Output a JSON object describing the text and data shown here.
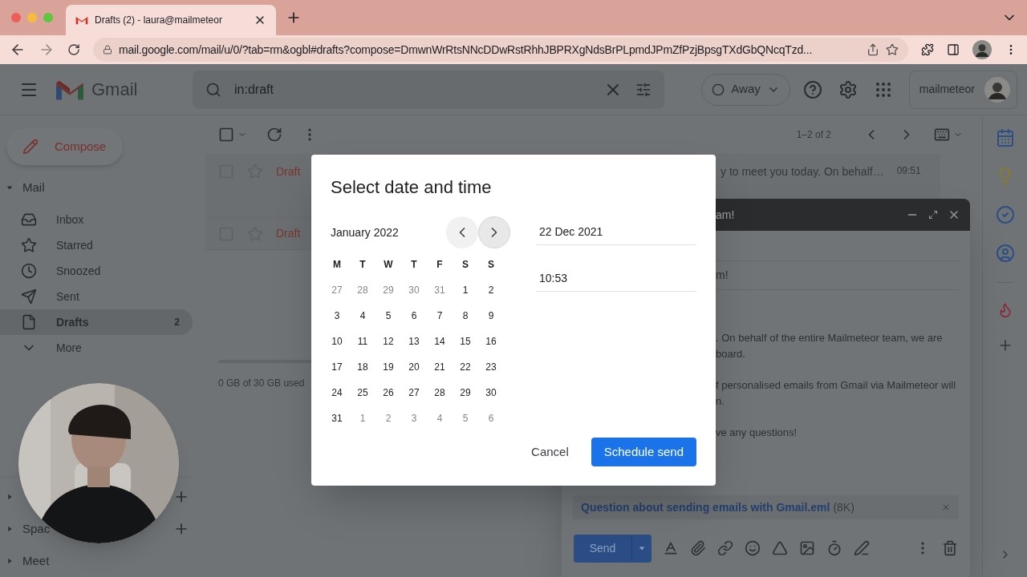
{
  "browser": {
    "tab_title": "Drafts (2) - laura@mailmeteor",
    "url": "mail.google.com/mail/u/0/?tab=rm&ogbl#drafts?compose=DmwnWrRtsNNcDDwRstRhhJBPRXgNdsBrPLpmdJPmZfPzjBpsgTXdGbQNcqTzd..."
  },
  "header": {
    "app_name": "Gmail",
    "search": {
      "value": "in:draft"
    },
    "status": "Away",
    "account": "mailmeteor"
  },
  "sidebar": {
    "compose": "Compose",
    "mail_section": {
      "label": "Mail",
      "expanded": true
    },
    "items": [
      {
        "label": "Inbox",
        "kind": "inbox",
        "selected": false
      },
      {
        "label": "Starred",
        "kind": "star",
        "selected": false
      },
      {
        "label": "Snoozed",
        "kind": "clock",
        "selected": false
      },
      {
        "label": "Sent",
        "kind": "send",
        "selected": false
      },
      {
        "label": "Drafts",
        "kind": "file",
        "count": "2",
        "selected": true
      },
      {
        "label": "More",
        "kind": "more",
        "selected": false
      }
    ],
    "sections": [
      {
        "addable": true
      },
      {
        "label": "Spac",
        "addable": true
      },
      {
        "label": "Meet",
        "addable": false
      }
    ]
  },
  "list": {
    "pagination": "1–2 of 2",
    "rows": [
      {
        "label": "Draft",
        "snippet": "y to meet you today. On behalf…",
        "time": "09:51"
      },
      {
        "label": "Draft"
      }
    ],
    "storage": "0 GB of 30 GB used"
  },
  "compose": {
    "title": "am!",
    "subject": "m!",
    "body": [
      [
        ". On behalf of the entire Mailmeteor team, we are",
        "board."
      ],
      [
        "f personalised emails from Gmail via Mailmeteor will",
        "n."
      ],
      [
        "ve any questions!"
      ]
    ],
    "attachment": {
      "name": "Question about sending emails with Gmail.eml",
      "size": "(8K)"
    },
    "send": "Send"
  },
  "dialog": {
    "title": "Select date and time",
    "month": "January 2022",
    "weekdays": [
      "M",
      "T",
      "W",
      "T",
      "F",
      "S",
      "S"
    ],
    "weeks": [
      [
        {
          "day": "27",
          "muted": true
        },
        {
          "day": "28",
          "muted": true
        },
        {
          "day": "29",
          "muted": true
        },
        {
          "day": "30",
          "muted": true
        },
        {
          "day": "31",
          "muted": true
        },
        {
          "day": "1",
          "muted": false
        },
        {
          "day": "2",
          "muted": false
        }
      ],
      [
        {
          "day": "3",
          "muted": false
        },
        {
          "day": "4",
          "muted": false
        },
        {
          "day": "5",
          "muted": false
        },
        {
          "day": "6",
          "muted": false
        },
        {
          "day": "7",
          "muted": false
        },
        {
          "day": "8",
          "muted": false
        },
        {
          "day": "9",
          "muted": false
        }
      ],
      [
        {
          "day": "10",
          "muted": false
        },
        {
          "day": "11",
          "muted": false
        },
        {
          "day": "12",
          "muted": false
        },
        {
          "day": "13",
          "muted": false
        },
        {
          "day": "14",
          "muted": false
        },
        {
          "day": "15",
          "muted": false
        },
        {
          "day": "16",
          "muted": false
        }
      ],
      [
        {
          "day": "17",
          "muted": false
        },
        {
          "day": "18",
          "muted": false
        },
        {
          "day": "19",
          "muted": false
        },
        {
          "day": "20",
          "muted": false
        },
        {
          "day": "21",
          "muted": false
        },
        {
          "day": "22",
          "muted": false
        },
        {
          "day": "23",
          "muted": false
        }
      ],
      [
        {
          "day": "24",
          "muted": false
        },
        {
          "day": "25",
          "muted": false
        },
        {
          "day": "26",
          "muted": false
        },
        {
          "day": "27",
          "muted": false
        },
        {
          "day": "28",
          "muted": false
        },
        {
          "day": "29",
          "muted": false
        },
        {
          "day": "30",
          "muted": false
        }
      ],
      [
        {
          "day": "31",
          "muted": false
        },
        {
          "day": "1",
          "muted": true
        },
        {
          "day": "2",
          "muted": true
        },
        {
          "day": "3",
          "muted": true
        },
        {
          "day": "4",
          "muted": true
        },
        {
          "day": "5",
          "muted": true
        },
        {
          "day": "6",
          "muted": true
        }
      ]
    ],
    "date": "22 Dec 2021",
    "time": "10:53",
    "cancel": "Cancel",
    "confirm": "Schedule send"
  }
}
